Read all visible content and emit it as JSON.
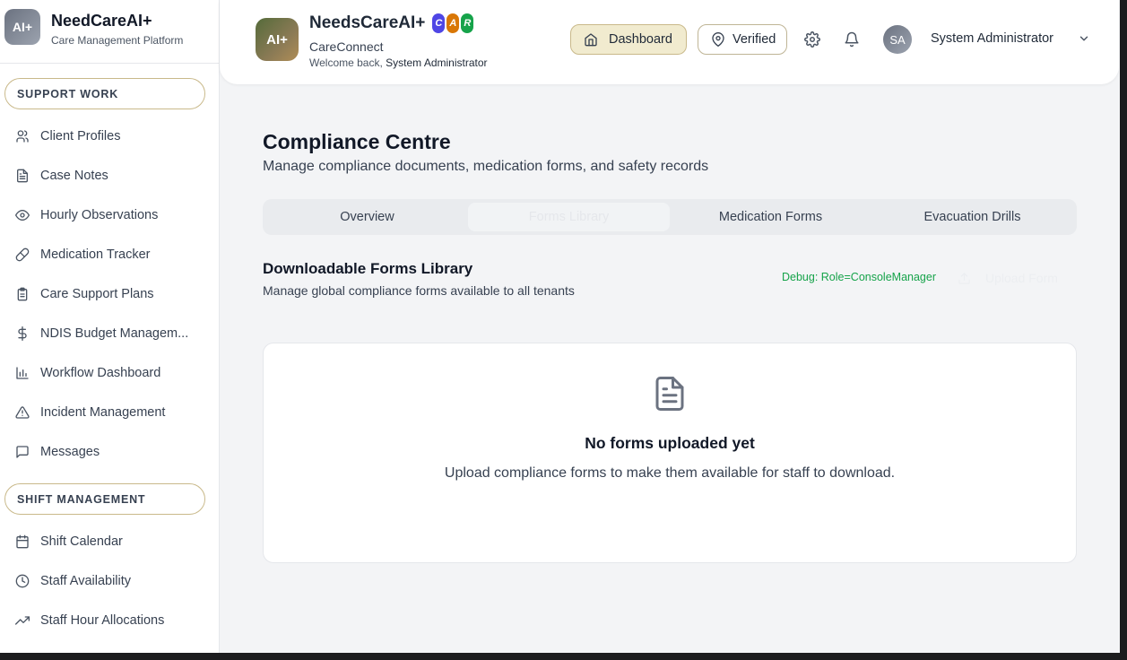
{
  "sidebar": {
    "brand_logo": "AI+",
    "brand_title": "NeedCareAI+",
    "brand_subtitle": "Care Management Platform",
    "sections": [
      {
        "title": "SUPPORT WORK",
        "items": [
          {
            "label": "Client Profiles",
            "icon": "users-icon"
          },
          {
            "label": "Case Notes",
            "icon": "document-icon"
          },
          {
            "label": "Hourly Observations",
            "icon": "eye-icon"
          },
          {
            "label": "Medication Tracker",
            "icon": "pill-icon"
          },
          {
            "label": "Care Support Plans",
            "icon": "clipboard-icon"
          },
          {
            "label": "NDIS Budget Managem...",
            "icon": "dollar-icon"
          },
          {
            "label": "Workflow Dashboard",
            "icon": "bar-chart-icon"
          },
          {
            "label": "Incident Management",
            "icon": "warning-icon"
          },
          {
            "label": "Messages",
            "icon": "message-icon"
          }
        ]
      },
      {
        "title": "SHIFT MANAGEMENT",
        "items": [
          {
            "label": "Shift Calendar",
            "icon": "calendar-icon"
          },
          {
            "label": "Staff Availability",
            "icon": "clock-icon"
          },
          {
            "label": "Staff Hour Allocations",
            "icon": "trending-up-icon"
          }
        ]
      }
    ]
  },
  "header": {
    "logo_text": "AI+",
    "app_title": "NeedsCareAI+",
    "badges": [
      "C",
      "A",
      "R"
    ],
    "badge_colors": [
      "#4f46e5",
      "#d97706",
      "#16a34a"
    ],
    "app_subtitle": "CareConnect",
    "welcome_prefix": "Welcome back,",
    "welcome_name": "System Administrator",
    "dashboard_label": "Dashboard",
    "verified_label": "Verified",
    "avatar_initials": "SA",
    "user_name": "System Administrator"
  },
  "main": {
    "title": "Compliance Centre",
    "subtitle": "Manage compliance documents, medication forms, and safety records",
    "tabs": [
      {
        "label": "Overview"
      },
      {
        "label": "Forms Library"
      },
      {
        "label": "Medication Forms"
      },
      {
        "label": "Evacuation Drills"
      }
    ],
    "active_tab": "Forms Library",
    "library_title": "Downloadable Forms Library",
    "library_subtitle": "Manage global compliance forms available to all tenants",
    "debug_text": "Debug: Role=ConsoleManager",
    "upload_label": "Upload Form",
    "empty_title": "No forms uploaded yet",
    "empty_text": "Upload compliance forms to make them available for staff to download."
  },
  "colors": {
    "accent_border": "#c9b98a",
    "dashboard_bg": "#f1ebcf",
    "debug_green": "#16a34a"
  }
}
